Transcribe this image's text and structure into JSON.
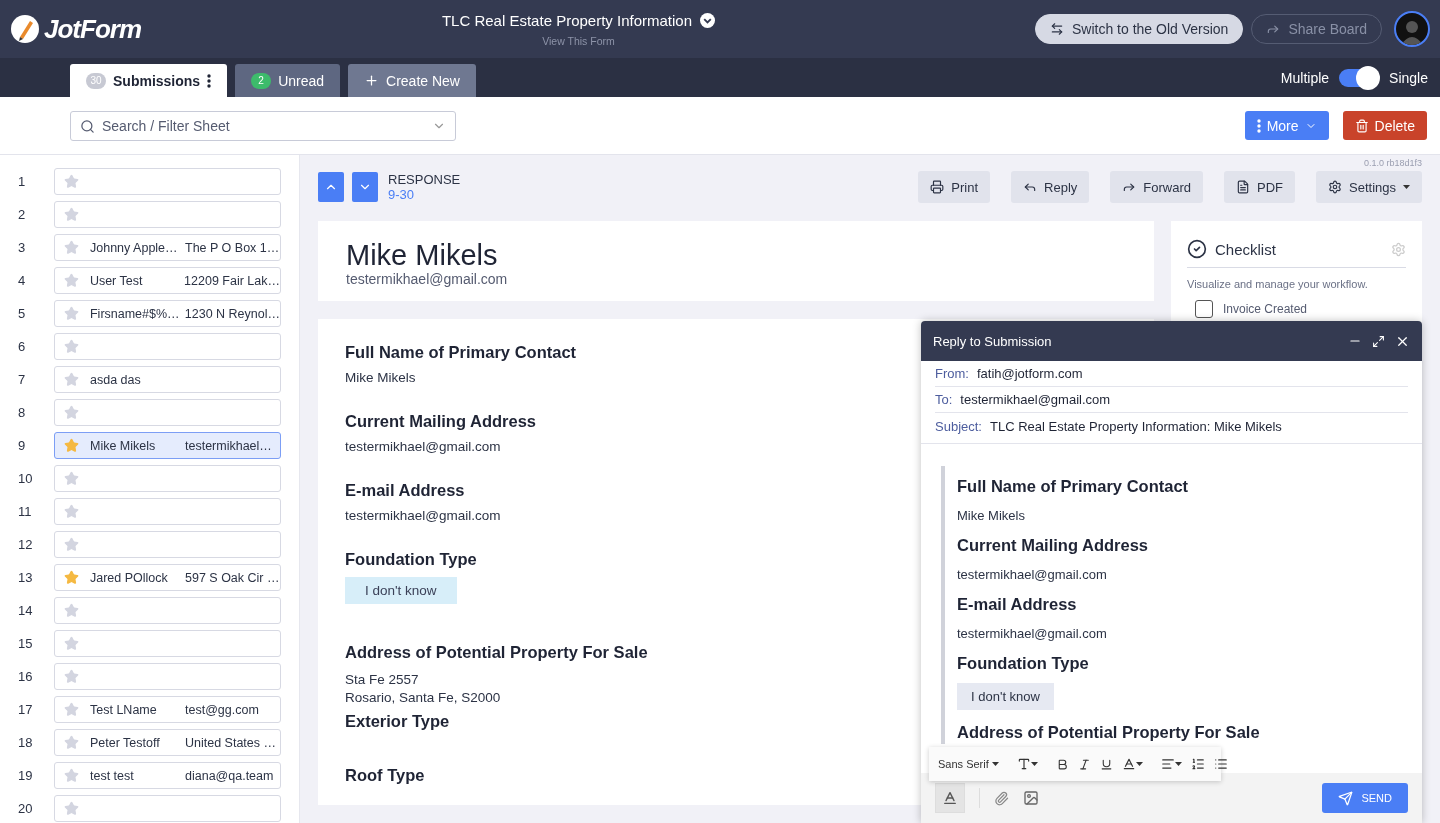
{
  "header": {
    "logo": "JotForm",
    "title": "TLC Real Estate Property Information",
    "subtitle": "View This Form",
    "buttons": [
      {
        "label": "Switch to the Old Version",
        "kind": "switch"
      },
      {
        "label": "Share Board",
        "kind": "share"
      }
    ]
  },
  "tabs": [
    {
      "label": "Submissions",
      "count": "30",
      "kind": "submissions",
      "selected": true
    },
    {
      "label": "Unread",
      "count": "2",
      "kind": "unread",
      "selected": false
    },
    {
      "label": "Create New",
      "kind": "create",
      "selected": false
    }
  ],
  "view_toggle": {
    "left": "Multiple",
    "right": "Single",
    "on": true
  },
  "search": {
    "placeholder": "Search / Filter Sheet"
  },
  "actions": [
    {
      "label": "More",
      "kind": "more"
    },
    {
      "label": "Delete",
      "kind": "delete"
    }
  ],
  "submissions": [
    {
      "number": "1",
      "starred": false,
      "selected": false
    },
    {
      "number": "2",
      "starred": false,
      "selected": false
    },
    {
      "number": "3",
      "starred": false,
      "selected": false,
      "name": "Johnny Apple…",
      "detail": "The P O Box 1…"
    },
    {
      "number": "4",
      "starred": false,
      "selected": false,
      "name": "User Test",
      "detail": "12209 Fair Lak…"
    },
    {
      "number": "5",
      "starred": false,
      "selected": false,
      "name": "Firsname#$%…",
      "detail": "1230 N Reynol…"
    },
    {
      "number": "6",
      "starred": false,
      "selected": false
    },
    {
      "number": "7",
      "starred": false,
      "selected": false,
      "name": "asda das"
    },
    {
      "number": "8",
      "starred": false,
      "selected": false
    },
    {
      "number": "9",
      "starred": true,
      "selected": true,
      "name": "Mike Mikels",
      "detail": "testermikhael…"
    },
    {
      "number": "10",
      "starred": false,
      "selected": false
    },
    {
      "number": "11",
      "starred": false,
      "selected": false
    },
    {
      "number": "12",
      "starred": false,
      "selected": false
    },
    {
      "number": "13",
      "starred": true,
      "selected": false,
      "name": "Jared POllock",
      "detail": "597 S Oak Cir …"
    },
    {
      "number": "14",
      "starred": false,
      "selected": false
    },
    {
      "number": "15",
      "starred": false,
      "selected": false
    },
    {
      "number": "16",
      "starred": false,
      "selected": false
    },
    {
      "number": "17",
      "starred": false,
      "selected": false,
      "name": "Test LName",
      "detail": "test@gg.com"
    },
    {
      "number": "18",
      "starred": false,
      "selected": false,
      "name": "Peter Testoff",
      "detail": "United States …"
    },
    {
      "number": "19",
      "starred": false,
      "selected": false,
      "name": "test test",
      "detail": "diana@qa.team"
    },
    {
      "number": "20",
      "starred": false,
      "selected": false
    }
  ],
  "response": {
    "label": "RESPONSE",
    "range": "9-30",
    "version": "0.1.0 rb18d1f3",
    "tools": [
      {
        "label": "Print",
        "kind": "print"
      },
      {
        "label": "Reply",
        "kind": "reply"
      },
      {
        "label": "Forward",
        "kind": "forward"
      },
      {
        "label": "PDF",
        "kind": "pdf"
      },
      {
        "label": "Settings",
        "kind": "settings"
      }
    ]
  },
  "contact": {
    "name": "Mike Mikels",
    "email": "testermikhael@gmail.com"
  },
  "fields": [
    {
      "question": "Full Name of Primary Contact",
      "kind": "text",
      "answer": "Mike Mikels"
    },
    {
      "question": "Current Mailing Address",
      "kind": "text",
      "answer": "testermikhael@gmail.com"
    },
    {
      "question": "E-mail Address",
      "kind": "text",
      "answer": "testermikhael@gmail.com"
    },
    {
      "question": "Foundation Type",
      "kind": "chip",
      "answer": "I don't know"
    },
    {
      "question": "Address of Potential Property For Sale",
      "kind": "lines",
      "lines": [
        "Sta Fe 2557",
        "Rosario, Santa Fe, S2000"
      ]
    },
    {
      "question": "Exterior Type",
      "kind": "empty"
    },
    {
      "question": "Roof Type",
      "kind": "empty"
    }
  ],
  "checklist": {
    "title": "Checklist",
    "description": "Visualize and manage your workflow.",
    "items": [
      {
        "label": "Invoice Created",
        "checked": false
      }
    ]
  },
  "reply": {
    "title": "Reply to Submission",
    "headers": [
      {
        "label": "From:",
        "value": "fatih@jotform.com"
      },
      {
        "label": "To:",
        "value": "testermikhael@gmail.com"
      },
      {
        "label": "Subject:",
        "value": "TLC Real Estate Property Information: Mike  Mikels"
      }
    ],
    "body": [
      {
        "kind": "heading",
        "text": "Full Name of Primary Contact"
      },
      {
        "kind": "text",
        "text": "Mike Mikels"
      },
      {
        "kind": "heading",
        "text": "Current Mailing Address"
      },
      {
        "kind": "text",
        "text": "testermikhael@gmail.com"
      },
      {
        "kind": "heading",
        "text": "E-mail Address"
      },
      {
        "kind": "text",
        "text": "testermikhael@gmail.com"
      },
      {
        "kind": "heading",
        "text": "Foundation Type"
      },
      {
        "kind": "chip",
        "text": "I don't know"
      },
      {
        "kind": "heading",
        "text": "Address of Potential Property For Sale"
      }
    ],
    "font": "Sans Serif",
    "send": "SEND"
  }
}
